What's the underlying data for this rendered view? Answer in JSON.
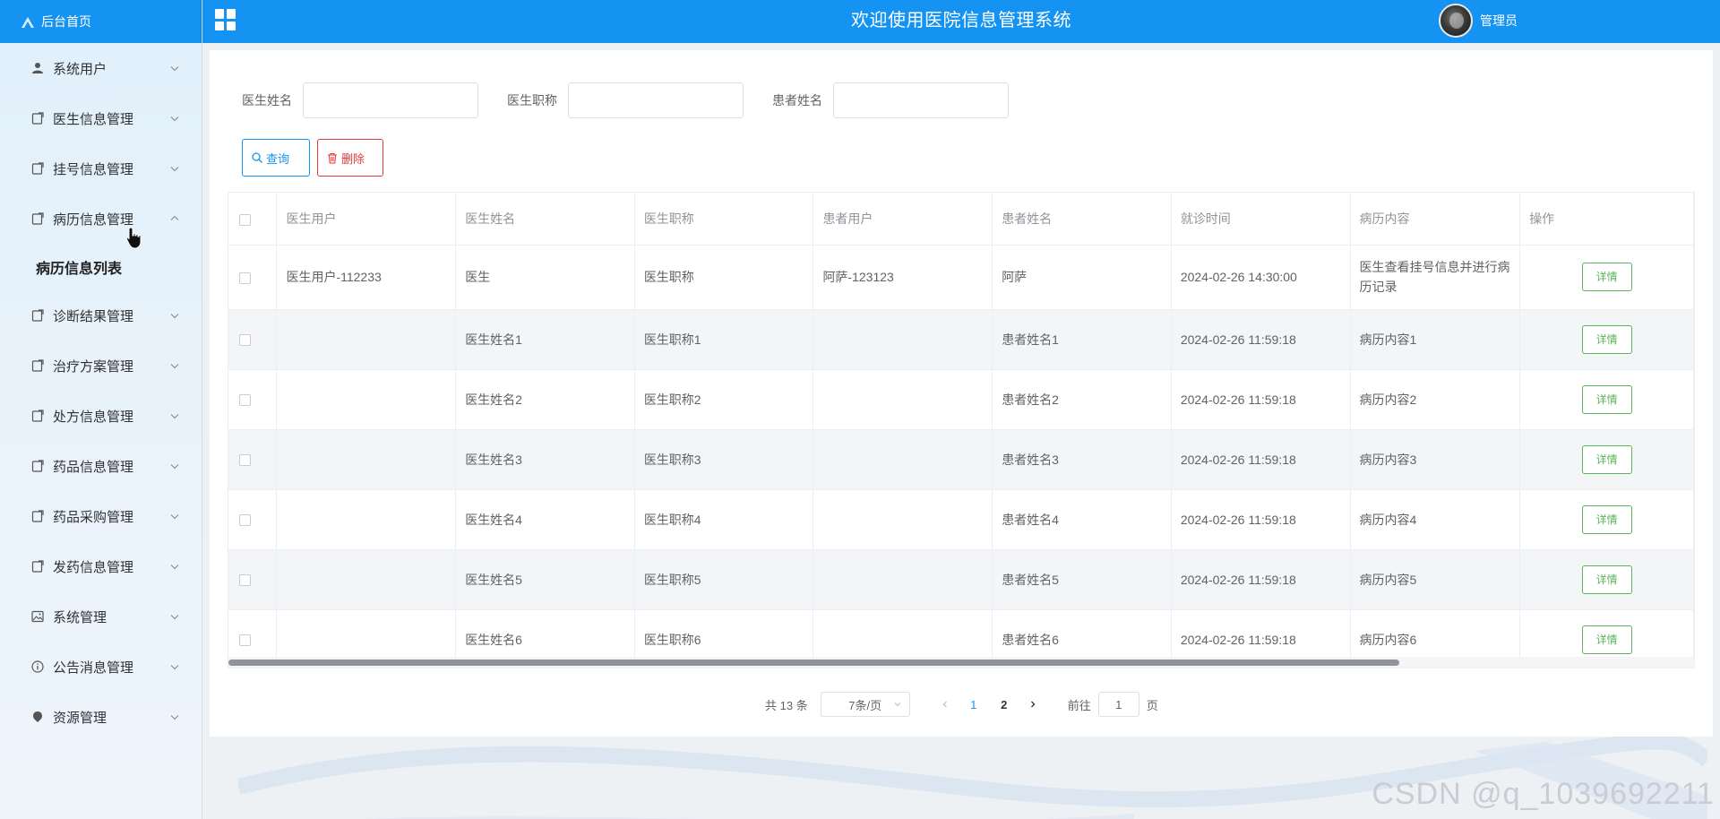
{
  "sidebar": {
    "home_label": "后台首页",
    "items": [
      {
        "label": "系统用户",
        "icon": "user-icon"
      },
      {
        "label": "医生信息管理",
        "icon": "doc-icon"
      },
      {
        "label": "挂号信息管理",
        "icon": "doc-icon"
      },
      {
        "label": "病历信息管理",
        "icon": "doc-icon",
        "expanded": true
      },
      {
        "label": "诊断结果管理",
        "icon": "doc-icon"
      },
      {
        "label": "治疗方案管理",
        "icon": "doc-icon"
      },
      {
        "label": "处方信息管理",
        "icon": "doc-icon"
      },
      {
        "label": "药品信息管理",
        "icon": "doc-icon"
      },
      {
        "label": "药品采购管理",
        "icon": "doc-icon"
      },
      {
        "label": "发药信息管理",
        "icon": "doc-icon"
      },
      {
        "label": "系统管理",
        "icon": "image-icon"
      },
      {
        "label": "公告消息管理",
        "icon": "info-icon"
      },
      {
        "label": "资源管理",
        "icon": "pin-icon"
      }
    ],
    "submenu": {
      "label": "病历信息列表"
    }
  },
  "header": {
    "title": "欢迎使用医院信息管理系统",
    "user_name": "管理员"
  },
  "search": {
    "doctor_name_label": "医生姓名",
    "doctor_title_label": "医生职称",
    "patient_name_label": "患者姓名",
    "doctor_name_value": "",
    "doctor_title_value": "",
    "patient_name_value": "",
    "query_label": "查询",
    "delete_label": "删除"
  },
  "table": {
    "columns": [
      "医生用户",
      "医生姓名",
      "医生职称",
      "患者用户",
      "患者姓名",
      "就诊时间",
      "病历内容",
      "操作"
    ],
    "detail_label": "详情",
    "rows": [
      {
        "doctor_user": "医生用户-112233",
        "doctor_name": "医生",
        "doctor_title": "医生职称",
        "patient_user": "阿萨-123123",
        "patient_name": "阿萨",
        "visit_time": "2024-02-26 14:30:00",
        "record": "医生查看挂号信息并进行病历记录"
      },
      {
        "doctor_user": "",
        "doctor_name": "医生姓名1",
        "doctor_title": "医生职称1",
        "patient_user": "",
        "patient_name": "患者姓名1",
        "visit_time": "2024-02-26 11:59:18",
        "record": "病历内容1"
      },
      {
        "doctor_user": "",
        "doctor_name": "医生姓名2",
        "doctor_title": "医生职称2",
        "patient_user": "",
        "patient_name": "患者姓名2",
        "visit_time": "2024-02-26 11:59:18",
        "record": "病历内容2"
      },
      {
        "doctor_user": "",
        "doctor_name": "医生姓名3",
        "doctor_title": "医生职称3",
        "patient_user": "",
        "patient_name": "患者姓名3",
        "visit_time": "2024-02-26 11:59:18",
        "record": "病历内容3"
      },
      {
        "doctor_user": "",
        "doctor_name": "医生姓名4",
        "doctor_title": "医生职称4",
        "patient_user": "",
        "patient_name": "患者姓名4",
        "visit_time": "2024-02-26 11:59:18",
        "record": "病历内容4"
      },
      {
        "doctor_user": "",
        "doctor_name": "医生姓名5",
        "doctor_title": "医生职称5",
        "patient_user": "",
        "patient_name": "患者姓名5",
        "visit_time": "2024-02-26 11:59:18",
        "record": "病历内容5"
      },
      {
        "doctor_user": "",
        "doctor_name": "医生姓名6",
        "doctor_title": "医生职称6",
        "patient_user": "",
        "patient_name": "患者姓名6",
        "visit_time": "2024-02-26 11:59:18",
        "record": "病历内容6"
      }
    ]
  },
  "pagination": {
    "total": "共 13 条",
    "page_size": "7条/页",
    "pages": [
      "1",
      "2"
    ],
    "current_page": "1",
    "goto_label": "前往",
    "goto_value": "1",
    "goto_suffix": "页"
  },
  "watermark": "CSDN @q_1039692211",
  "colors": {
    "primary": "#1493f2",
    "danger": "#e03a3a",
    "success": "#5bb35b"
  }
}
